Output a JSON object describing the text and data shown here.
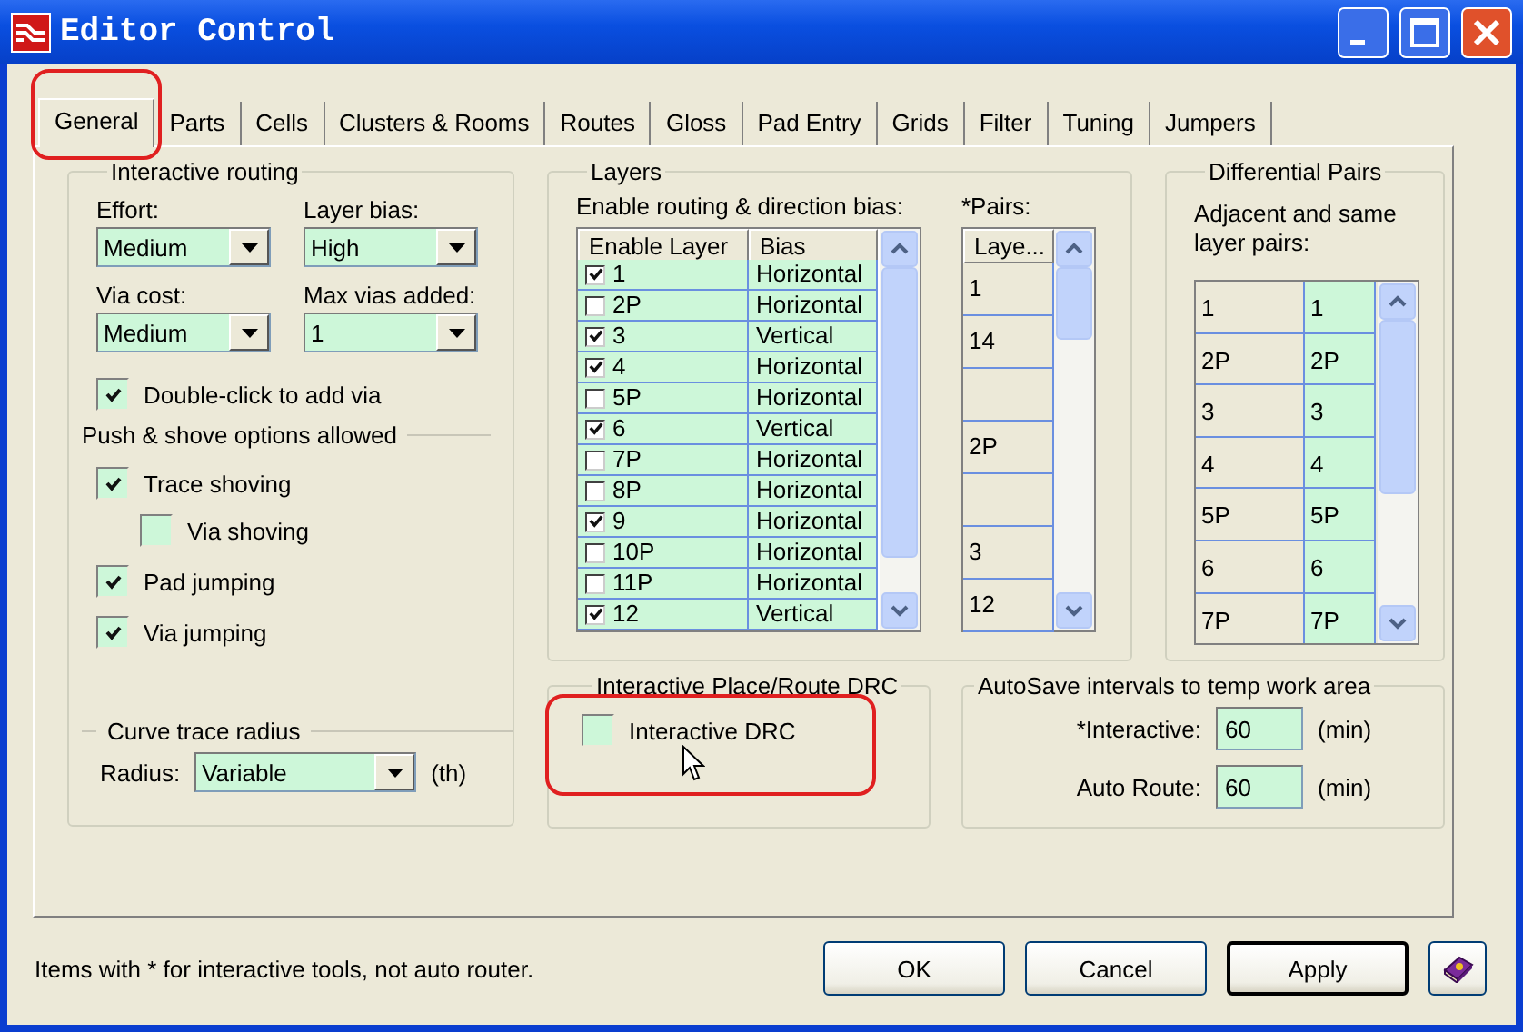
{
  "window": {
    "title": "Editor Control"
  },
  "tabs": [
    {
      "label": "General",
      "selected": true
    },
    {
      "label": "Parts",
      "selected": false
    },
    {
      "label": "Cells",
      "selected": false
    },
    {
      "label": "Clusters & Rooms",
      "selected": false
    },
    {
      "label": "Routes",
      "selected": false
    },
    {
      "label": "Gloss",
      "selected": false
    },
    {
      "label": "Pad Entry",
      "selected": false
    },
    {
      "label": "Grids",
      "selected": false
    },
    {
      "label": "Filter",
      "selected": false
    },
    {
      "label": "Tuning",
      "selected": false
    },
    {
      "label": "Jumpers",
      "selected": false
    }
  ],
  "interactive_routing": {
    "title": "Interactive routing",
    "selects": [
      {
        "label": "Effort:",
        "value": "Medium"
      },
      {
        "label": "Layer bias:",
        "value": "High"
      },
      {
        "label": "Via cost:",
        "value": "Medium"
      },
      {
        "label": "Max vias added:",
        "value": "1"
      }
    ],
    "double_click": {
      "label": "Double-click to add via",
      "checked": true
    },
    "push_shove": {
      "title": "Push & shove options allowed",
      "options": [
        {
          "label": "Trace shoving",
          "checked": true,
          "children": [
            {
              "label": "Via shoving",
              "checked": false
            }
          ]
        },
        {
          "label": "Pad jumping",
          "checked": true
        },
        {
          "label": "Via jumping",
          "checked": true
        }
      ]
    },
    "curve": {
      "title": "Curve trace radius",
      "label": "Radius:",
      "value": "Variable",
      "unit": "(th)"
    }
  },
  "layers": {
    "title": "Layers",
    "caption": "Enable routing & direction bias:",
    "columns": [
      "Enable Layer",
      "Bias"
    ],
    "rows": [
      {
        "layer": "1",
        "enabled": true,
        "bias": "Horizontal"
      },
      {
        "layer": "2P",
        "enabled": false,
        "bias": "Horizontal"
      },
      {
        "layer": "3",
        "enabled": true,
        "bias": "Vertical"
      },
      {
        "layer": "4",
        "enabled": true,
        "bias": "Horizontal"
      },
      {
        "layer": "5P",
        "enabled": false,
        "bias": "Horizontal"
      },
      {
        "layer": "6",
        "enabled": true,
        "bias": "Vertical"
      },
      {
        "layer": "7P",
        "enabled": false,
        "bias": "Horizontal"
      },
      {
        "layer": "8P",
        "enabled": false,
        "bias": "Horizontal"
      },
      {
        "layer": "9",
        "enabled": true,
        "bias": "Horizontal"
      },
      {
        "layer": "10P",
        "enabled": false,
        "bias": "Horizontal"
      },
      {
        "layer": "11P",
        "enabled": false,
        "bias": "Horizontal"
      },
      {
        "layer": "12",
        "enabled": true,
        "bias": "Vertical"
      }
    ],
    "pairs": {
      "caption": "*Pairs:",
      "column": "Laye...",
      "rows": [
        {
          "layer": "1"
        },
        {
          "layer": "14"
        },
        {},
        {
          "layer": "2P"
        },
        {},
        {
          "layer": "3"
        },
        {
          "layer": "12"
        }
      ]
    }
  },
  "differential_pairs": {
    "title": "Differential Pairs",
    "caption": "Adjacent and same layer pairs:",
    "rows": [
      {
        "first": "1",
        "second": "1"
      },
      {
        "first": "2P",
        "second": "2P"
      },
      {
        "first": "3",
        "second": "3"
      },
      {
        "first": "4",
        "second": "4"
      },
      {
        "first": "5P",
        "second": "5P"
      },
      {
        "first": "6",
        "second": "6"
      },
      {
        "first": "7P",
        "second": "7P"
      }
    ]
  },
  "drc": {
    "title": "Interactive Place/Route DRC",
    "option": {
      "label": "Interactive DRC",
      "checked": false
    }
  },
  "autosave": {
    "title": "AutoSave intervals to temp work area",
    "fields": [
      {
        "label": "*Interactive:",
        "value": "60",
        "unit": "(min)"
      },
      {
        "label": "Auto Route:",
        "value": "60",
        "unit": "(min)"
      }
    ]
  },
  "footer_note": "Items with * for interactive tools, not auto router.",
  "buttons": [
    {
      "label": "OK",
      "default": false
    },
    {
      "label": "Cancel",
      "default": false
    },
    {
      "label": "Apply",
      "default": true
    }
  ]
}
